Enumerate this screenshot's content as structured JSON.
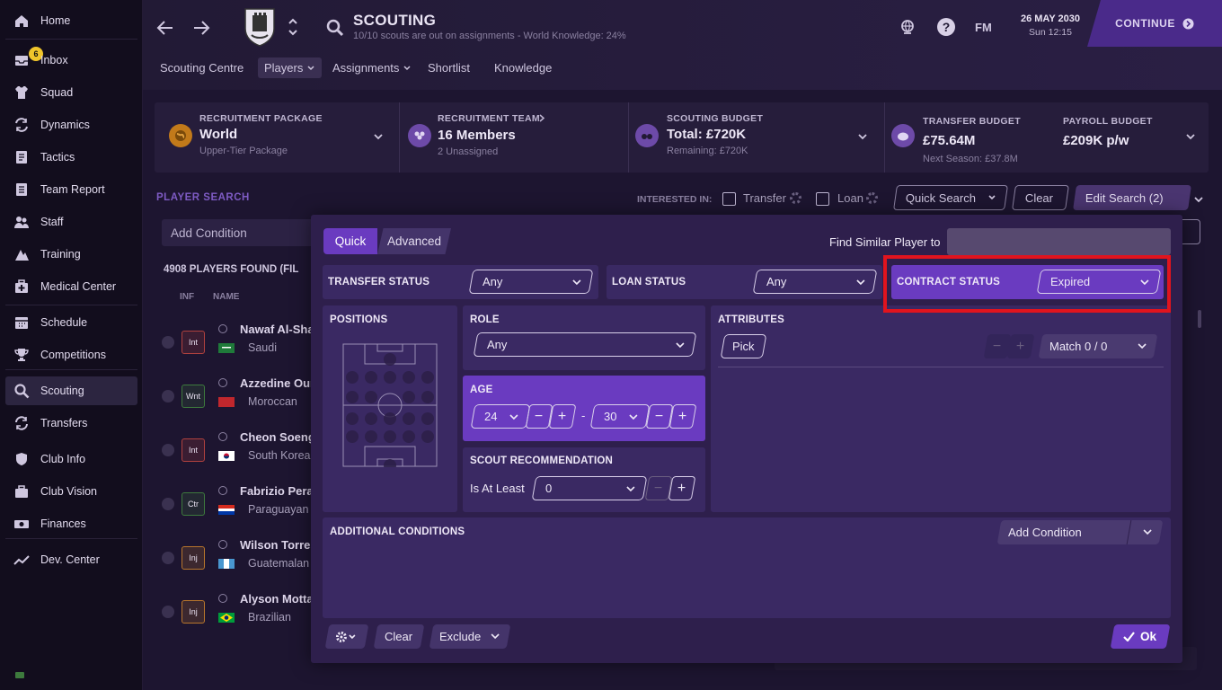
{
  "sidebar": {
    "items": [
      {
        "label": "Home",
        "icon": "home-icon"
      },
      {
        "label": "Inbox",
        "icon": "inbox-icon",
        "badge": "6"
      },
      {
        "label": "Squad",
        "icon": "shirt-icon"
      },
      {
        "label": "Dynamics",
        "icon": "dynamics-icon"
      },
      {
        "label": "Tactics",
        "icon": "tactics-icon"
      },
      {
        "label": "Team Report",
        "icon": "report-icon"
      },
      {
        "label": "Staff",
        "icon": "staff-icon"
      },
      {
        "label": "Training",
        "icon": "training-icon"
      },
      {
        "label": "Medical Center",
        "icon": "medical-icon"
      },
      {
        "label": "Schedule",
        "icon": "calendar-icon"
      },
      {
        "label": "Competitions",
        "icon": "trophy-icon"
      },
      {
        "label": "Scouting",
        "icon": "search-icon"
      },
      {
        "label": "Transfers",
        "icon": "transfer-icon"
      },
      {
        "label": "Club Info",
        "icon": "shield-icon"
      },
      {
        "label": "Club Vision",
        "icon": "briefcase-icon"
      },
      {
        "label": "Finances",
        "icon": "money-icon"
      },
      {
        "label": "Dev. Center",
        "icon": "chart-icon"
      }
    ],
    "active": "Scouting"
  },
  "header": {
    "title": "SCOUTING",
    "subtitle": "10/10 scouts are out on assignments - World Knowledge: 24%",
    "fm_label": "FM",
    "date": "26 MAY 2030",
    "time": "Sun 12:15",
    "continue_label": "CONTINUE",
    "tabs": [
      "Scouting Centre",
      "Players",
      "Assignments",
      "Shortlist",
      "Knowledge"
    ],
    "active_tab": "Players"
  },
  "cards": {
    "package": {
      "title": "RECRUITMENT PACKAGE",
      "value": "World",
      "sub": "Upper-Tier Package"
    },
    "team": {
      "title": "RECRUITMENT TEAM",
      "value": "16 Members",
      "sub": "2 Unassigned"
    },
    "budget": {
      "title": "SCOUTING BUDGET",
      "value": "Total: £720K",
      "sub": "Remaining: £720K"
    },
    "transfer": {
      "title": "TRANSFER BUDGET",
      "value": "£75.64M",
      "sub": "Next Season: £37.8M"
    },
    "payroll": {
      "title": "PAYROLL BUDGET",
      "value": "£209K p/w"
    }
  },
  "player_search": {
    "title": "PLAYER SEARCH",
    "interested_in": "INTERESTED IN:",
    "transfer": "Transfer",
    "loan": "Loan",
    "quick_search": "Quick Search",
    "clear": "Clear",
    "edit_search": "Edit Search (2)",
    "add_condition": "Add Condition",
    "found": "4908 PLAYERS FOUND (FIL",
    "col_inf": "INF",
    "col_name": "NAME"
  },
  "players": [
    {
      "name": "Nawaf Al-Shar",
      "nationality": "Saudi",
      "inf": "Int",
      "inf_color": "#b0413e"
    },
    {
      "name": "Azzedine Ouna",
      "nationality": "Moroccan",
      "inf": "Wnt",
      "inf_color": "#3d7a3d"
    },
    {
      "name": "Cheon Soeng-I",
      "nationality": "South Korean",
      "inf": "Int",
      "inf_color": "#b0413e"
    },
    {
      "name": "Fabrizio Peralt",
      "nationality": "Paraguayan",
      "inf": "Ctr",
      "inf_color": "#3d7a3d"
    },
    {
      "name": "Wilson Torres",
      "nationality": "Guatemalan",
      "inf": "Inj",
      "inf_color": "#b8762c"
    },
    {
      "name": "Alyson Motta",
      "nationality": "Brazilian",
      "inf": "Inj",
      "inf_color": "#b8762c"
    }
  ],
  "modal": {
    "tab_quick": "Quick",
    "tab_advanced": "Advanced",
    "find_similar": "Find Similar Player to",
    "transfer_status": {
      "label": "TRANSFER STATUS",
      "value": "Any"
    },
    "loan_status": {
      "label": "LOAN STATUS",
      "value": "Any"
    },
    "contract_status": {
      "label": "CONTRACT STATUS",
      "value": "Expired"
    },
    "positions": "POSITIONS",
    "role": {
      "label": "ROLE",
      "value": "Any"
    },
    "age": {
      "label": "AGE",
      "min": "24",
      "max": "30",
      "sep": "-"
    },
    "scout_rec": {
      "label": "SCOUT RECOMMENDATION",
      "prefix": "Is At Least",
      "value": "0"
    },
    "attributes": {
      "label": "ATTRIBUTES",
      "pick": "Pick",
      "match": "Match 0 / 0"
    },
    "additional": {
      "label": "ADDITIONAL CONDITIONS",
      "add": "Add Condition"
    },
    "footer": {
      "clear": "Clear",
      "exclude": "Exclude",
      "ok": "Ok"
    }
  }
}
